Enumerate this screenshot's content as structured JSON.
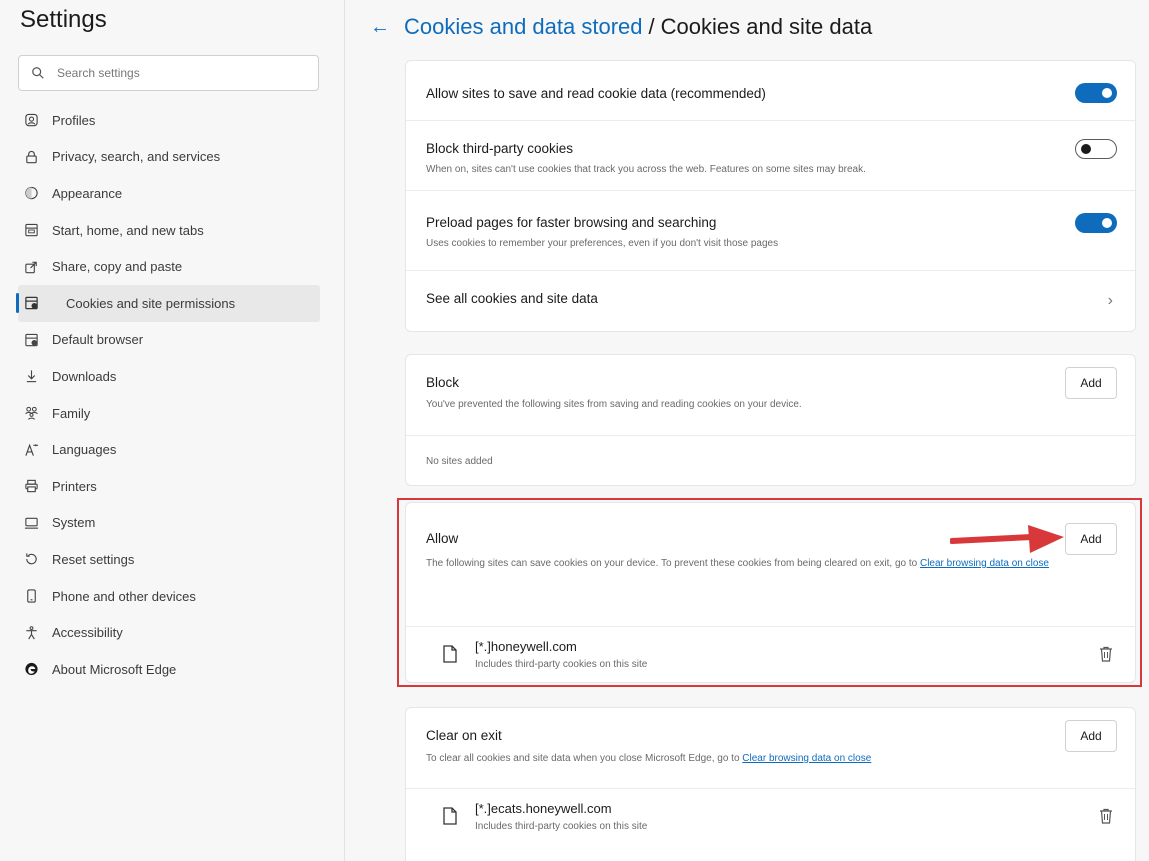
{
  "sidebar": {
    "title": "Settings",
    "search_placeholder": "Search settings",
    "items": [
      {
        "label": "Profiles",
        "icon": "profile-icon"
      },
      {
        "label": "Privacy, search, and services",
        "icon": "lock-icon"
      },
      {
        "label": "Appearance",
        "icon": "appearance-icon"
      },
      {
        "label": "Start, home, and new tabs",
        "icon": "home-tabs-icon"
      },
      {
        "label": "Share, copy and paste",
        "icon": "share-icon"
      },
      {
        "label": "Cookies and site permissions",
        "icon": "cookies-icon",
        "active": true
      },
      {
        "label": "Default browser",
        "icon": "browser-icon"
      },
      {
        "label": "Downloads",
        "icon": "download-icon"
      },
      {
        "label": "Family",
        "icon": "family-icon"
      },
      {
        "label": "Languages",
        "icon": "languages-icon"
      },
      {
        "label": "Printers",
        "icon": "printer-icon"
      },
      {
        "label": "System",
        "icon": "system-icon"
      },
      {
        "label": "Reset settings",
        "icon": "reset-icon"
      },
      {
        "label": "Phone and other devices",
        "icon": "phone-icon"
      },
      {
        "label": "Accessibility",
        "icon": "accessibility-icon"
      },
      {
        "label": "About Microsoft Edge",
        "icon": "edge-icon"
      }
    ]
  },
  "breadcrumb": {
    "back_glyph": "←",
    "parent": "Cookies and data stored",
    "separator": "/",
    "current": "Cookies and site data"
  },
  "settings_card": {
    "allow_sites": {
      "title": "Allow sites to save and read cookie data (recommended)",
      "enabled": true
    },
    "block_third_party": {
      "title": "Block third-party cookies",
      "description": "When on, sites can't use cookies that track you across the web. Features on some sites may break.",
      "enabled": false
    },
    "preload": {
      "title": "Preload pages for faster browsing and searching",
      "description": "Uses cookies to remember your preferences, even if you don't visit those pages",
      "enabled": true
    },
    "see_all": {
      "title": "See all cookies and site data",
      "chevron": "›"
    }
  },
  "block": {
    "title": "Block",
    "description": "You've prevented the following sites from saving and reading cookies on your device.",
    "add_label": "Add",
    "empty_text": "No sites added"
  },
  "allow": {
    "title": "Allow",
    "description_prefix": "The following sites can save cookies on your device. To prevent these cookies from being cleared on exit, go to ",
    "description_link": "Clear browsing data on close",
    "add_label": "Add",
    "sites": [
      {
        "name": "[*.]honeywell.com",
        "detail": "Includes third-party cookies on this site"
      }
    ]
  },
  "clear_on_exit": {
    "title": "Clear on exit",
    "description_prefix": "To clear all cookies and site data when you close Microsoft Edge, go to ",
    "description_link": "Clear browsing data on close",
    "add_label": "Add",
    "sites": [
      {
        "name": "[*.]ecats.honeywell.com",
        "detail": "Includes third-party cookies on this site"
      }
    ]
  },
  "colors": {
    "accent": "#0f6cbd",
    "highlight": "#d9383a"
  }
}
